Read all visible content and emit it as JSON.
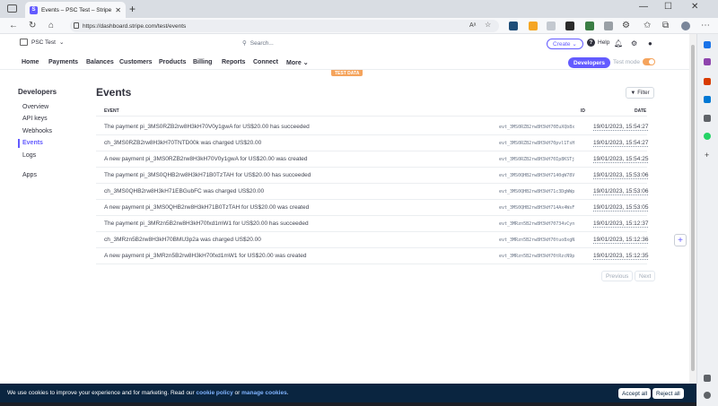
{
  "browser": {
    "tab_title": "Events – PSC Test – Stripe [Test]",
    "favicon_letter": "S",
    "url": "https://dashboard.stripe.com/test/events"
  },
  "header": {
    "account": "PSC Test",
    "search_placeholder": "Search...",
    "create_label": "Create",
    "help_label": "Help"
  },
  "nav": {
    "items": [
      "Home",
      "Payments",
      "Balances",
      "Customers",
      "Products",
      "Billing",
      "Reports",
      "Connect",
      "More"
    ],
    "developers_label": "Developers",
    "test_mode_label": "Test mode",
    "test_data_badge": "TEST DATA"
  },
  "sidebar": {
    "title": "Developers",
    "items": [
      "Overview",
      "API keys",
      "Webhooks",
      "Events",
      "Logs",
      "Apps"
    ]
  },
  "main": {
    "title": "Events",
    "filter_label": "Filter",
    "columns": {
      "event": "EVENT",
      "id": "ID",
      "date": "DATE"
    },
    "rows": [
      {
        "desc": "The payment pi_3MS0RZB2rw8H3kH70V0y1gwA for US$20.00 has succeeded",
        "id": "evt_3MS0RZB2rw8H3kH70EuXQb8x",
        "date": "19/01/2023, 15:54:27"
      },
      {
        "desc": "ch_3MS0RZB2rw8H3kH70TNTD00k was charged US$20.00",
        "id": "evt_3MS0RZB2rw8H3kH70pvl1TsH",
        "date": "19/01/2023, 15:54:27"
      },
      {
        "desc": "A new payment pi_3MS0RZB2rw8H3kH70V0y1gwA for US$20.00 was created",
        "id": "evt_3MS0RZB2rw8H3kH70Ip8KSTj",
        "date": "19/01/2023, 15:54:25"
      },
      {
        "desc": "The payment pi_3MS0QHB2rw8H3kH71B0TzTAH for US$20.00 has succeeded",
        "id": "evt_3MS0QHB2rw8H3kH7140qW78V",
        "date": "19/01/2023, 15:53:06"
      },
      {
        "desc": "ch_3MS0QHB2rw8H3kH71EBGubFC was charged US$20.00",
        "id": "evt_3MS0QHB2rw8H3kH71c3DgWWp",
        "date": "19/01/2023, 15:53:06"
      },
      {
        "desc": "A new payment pi_3MS0QHB2rw8H3kH71B0TzTAH for US$20.00 was created",
        "id": "evt_3MS0QHB2rw8H3kH714Ax4WsF",
        "date": "19/01/2023, 15:53:05"
      },
      {
        "desc": "The payment pi_3MRzn5B2rw8H3kH70fxd1mW1 for US$20.00 has succeeded",
        "id": "evt_3MRzn5B2rw8H3kH70734vCyn",
        "date": "19/01/2023, 15:12:37"
      },
      {
        "desc": "ch_3MRzn5B2rw8H3kH70BMU3p2a was charged US$20.00",
        "id": "evt_3MRzn5B2rw8H3kH70tuo8xgN",
        "date": "19/01/2023, 15:12:36"
      },
      {
        "desc": "A new payment pi_3MRzn5B2rw8H3kH70fxd1mW1 for US$20.00 was created",
        "id": "evt_3MRzn5B2rw8H3kH70tRzcN9p",
        "date": "19/01/2023, 15:12:35"
      }
    ],
    "previous_label": "Previous",
    "next_label": "Next"
  },
  "cookie": {
    "text_before": "We use cookies to improve your experience and for marketing. Read our ",
    "policy_link": "cookie policy",
    "text_middle": " or ",
    "manage_link": "manage cookies",
    "text_after": ".",
    "accept_label": "Accept all",
    "reject_label": "Reject all"
  },
  "colors": {
    "brand": "#635bff",
    "test_mode": "#f5a45d",
    "cookie_bg": "#0a2540"
  }
}
